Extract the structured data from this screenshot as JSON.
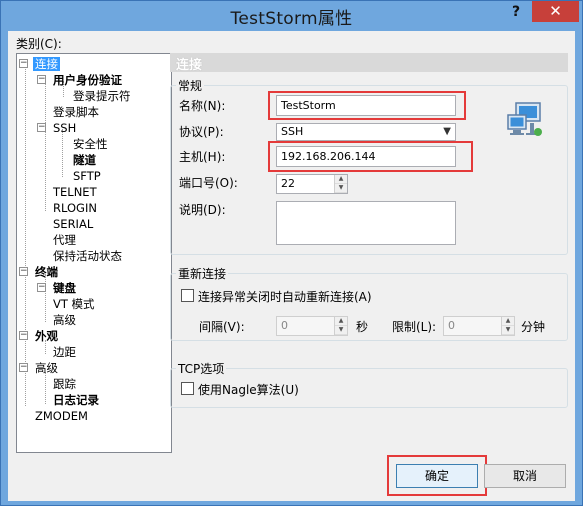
{
  "window": {
    "title": "TestStorm属性",
    "help": "?",
    "close": "✕"
  },
  "category_label": "类别(C):",
  "tree": {
    "connection": "连接",
    "auth": "用户身份验证",
    "login_prompts": "登录提示符",
    "login_script": "登录脚本",
    "ssh": "SSH",
    "security": "安全性",
    "tunnel": "隧道",
    "sftp": "SFTP",
    "telnet": "TELNET",
    "rlogin": "RLOGIN",
    "serial": "SERIAL",
    "proxy": "代理",
    "keepalive": "保持活动状态",
    "terminal": "终端",
    "keyboard": "键盘",
    "vt_mode": "VT 模式",
    "advanced1": "高级",
    "appearance": "外观",
    "margin": "边距",
    "advanced2": "高级",
    "trace": "跟踪",
    "logging": "日志记录",
    "zmodem": "ZMODEM"
  },
  "panel": {
    "header": "连接",
    "general": {
      "title": "常规",
      "name_label": "名称(N):",
      "name_value": "TestStorm",
      "protocol_label": "协议(P):",
      "protocol_value": "SSH",
      "host_label": "主机(H):",
      "host_value": "192.168.206.144",
      "port_label": "端口号(O):",
      "port_value": "22",
      "desc_label": "说明(D):",
      "desc_value": ""
    },
    "reconnect": {
      "title": "重新连接",
      "auto_label": "连接异常关闭时自动重新连接(A)",
      "interval_label": "间隔(V):",
      "interval_value": "0",
      "seconds": "秒",
      "limit_label": "限制(L):",
      "limit_value": "0",
      "minutes": "分钟"
    },
    "tcp": {
      "title": "TCP选项",
      "nagle_label": "使用Nagle算法(U)"
    }
  },
  "buttons": {
    "ok": "确定",
    "cancel": "取消"
  },
  "colors": {
    "highlight": "#e43a3a",
    "selection": "#3399ff",
    "title_bar": "#6fa7de"
  }
}
